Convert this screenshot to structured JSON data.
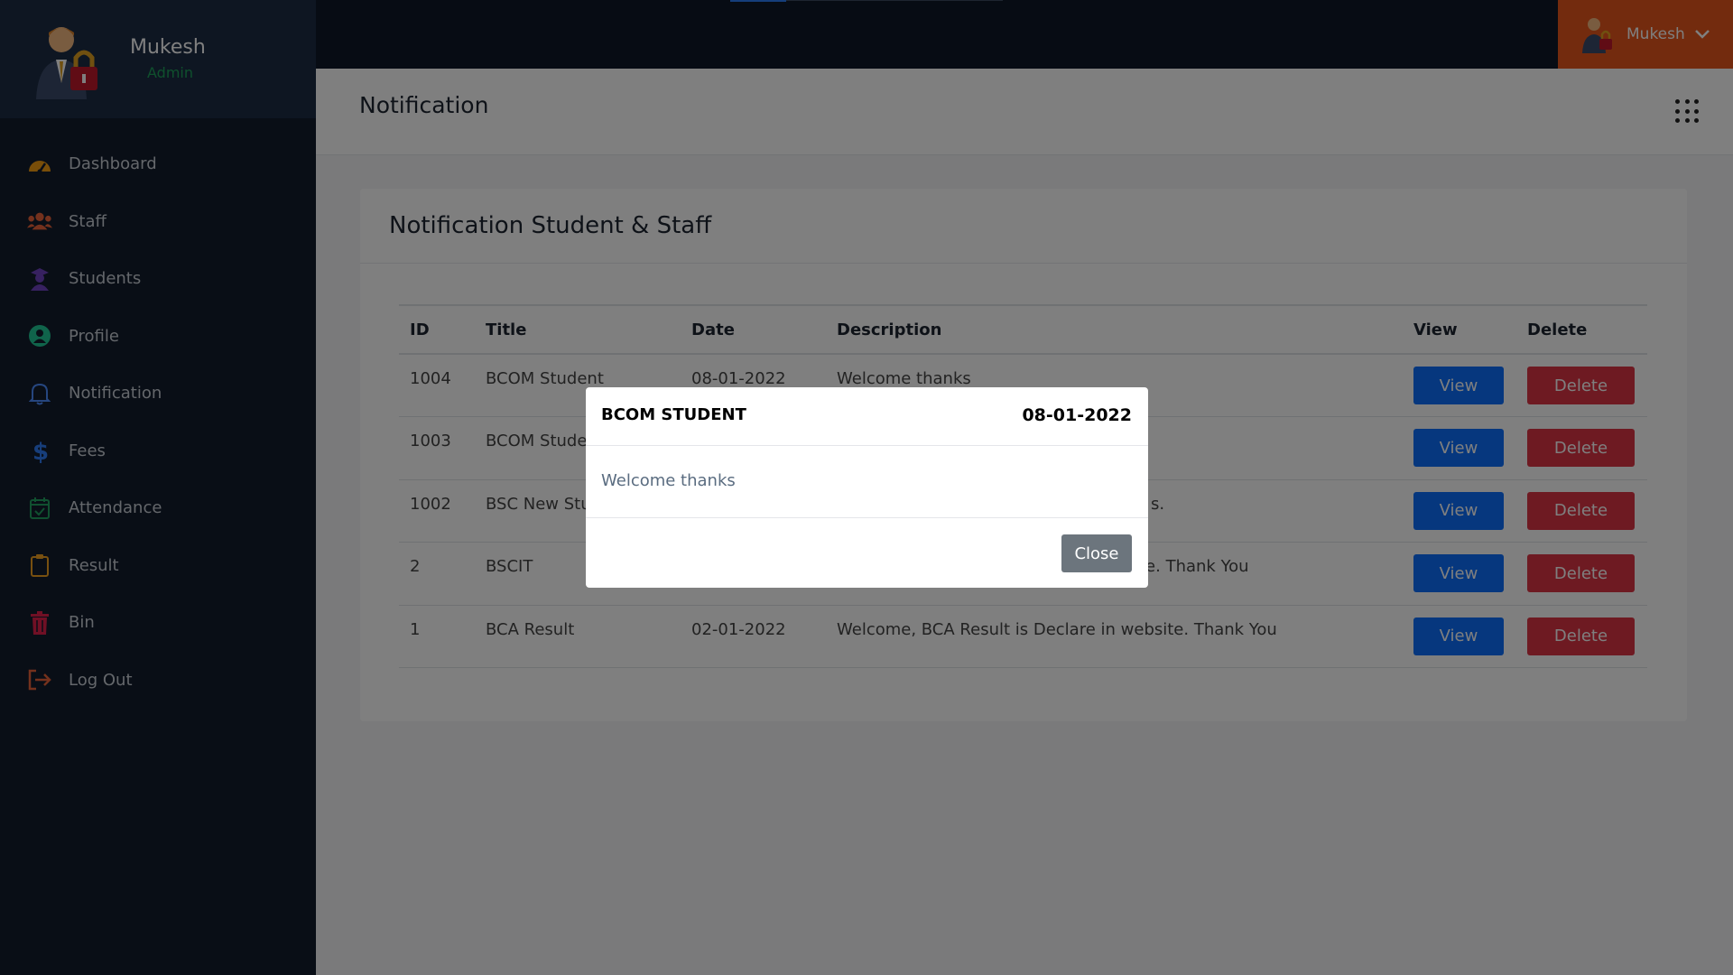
{
  "sidebar": {
    "user": {
      "name": "Mukesh",
      "role": "Admin"
    },
    "items": [
      {
        "label": "Dashboard",
        "icon": "speedometer-icon",
        "color": "#f39c12"
      },
      {
        "label": "Staff",
        "icon": "users-icon",
        "color": "#e8623a"
      },
      {
        "label": "Students",
        "icon": "graduate-icon",
        "color": "#6f42c1"
      },
      {
        "label": "Profile",
        "icon": "user-circle-icon",
        "color": "#20c997"
      },
      {
        "label": "Notification",
        "icon": "bell-icon",
        "color": "#4c8dff"
      },
      {
        "label": "Fees",
        "icon": "dollar-icon",
        "color": "#2f7df6"
      },
      {
        "label": "Attendance",
        "icon": "calendar-check-icon",
        "color": "#20a060"
      },
      {
        "label": "Result",
        "icon": "clipboard-icon",
        "color": "#f0a020"
      },
      {
        "label": "Bin",
        "icon": "trash-icon",
        "color": "#e0204a"
      },
      {
        "label": "Log Out",
        "icon": "logout-icon",
        "color": "#e8623a"
      }
    ]
  },
  "topbar": {
    "user_name": "Mukesh",
    "accent": "#e6571c"
  },
  "page": {
    "title": "Notification"
  },
  "card": {
    "title": "Notification Student & Staff"
  },
  "table": {
    "headers": {
      "id": "ID",
      "title": "Title",
      "date": "Date",
      "description": "Description",
      "view": "View",
      "delete": "Delete"
    },
    "rows": [
      {
        "id": "1004",
        "title": "BCOM Student",
        "date": "08-01-2022",
        "description": "Welcome thanks",
        "view": "View",
        "delete": "Delete"
      },
      {
        "id": "1003",
        "title": "BCOM Stude",
        "date": "",
        "description": "",
        "view": "View",
        "delete": "Delete"
      },
      {
        "id": "1002",
        "title": "BSC New Stu",
        "date": "",
        "description": "s.",
        "view": "View",
        "delete": "Delete"
      },
      {
        "id": "2",
        "title": "BSCIT",
        "date": "",
        "description": "ite. Thank You",
        "view": "View",
        "delete": "Delete"
      },
      {
        "id": "1",
        "title": "BCA Result",
        "date": "02-01-2022",
        "description": "Welcome, BCA Result is Declare in website. Thank You",
        "view": "View",
        "delete": "Delete"
      }
    ]
  },
  "modal": {
    "title": "BCOM STUDENT",
    "date": "08-01-2022",
    "body": "Welcome thanks",
    "close_label": "Close"
  }
}
